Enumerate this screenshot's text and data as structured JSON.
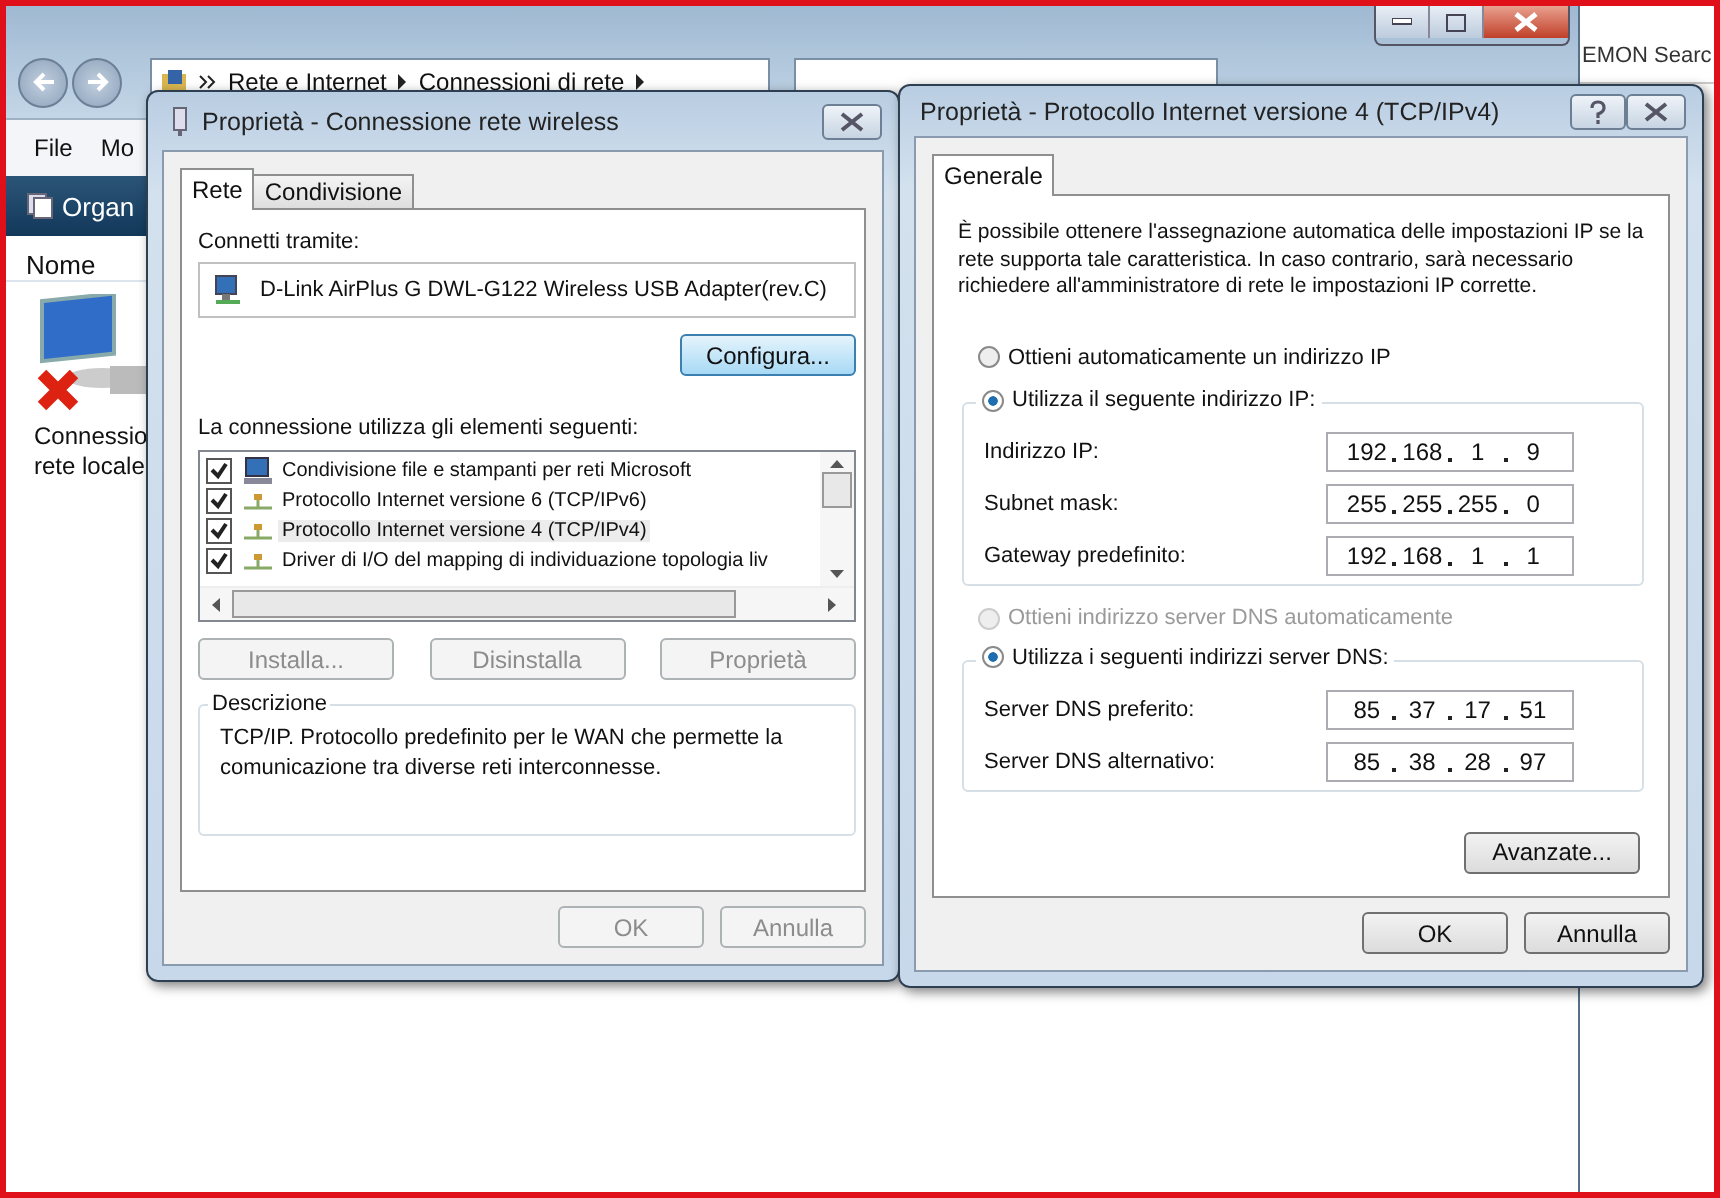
{
  "explorer": {
    "breadcrumb": [
      "Rete e Internet",
      "Connessioni di rete"
    ],
    "menu": [
      "File",
      "Mo"
    ],
    "toolbar_button": "Organ",
    "column": "Nome",
    "item_label": [
      "Connessio",
      "rete locale"
    ],
    "other_window_title": "EMON Searc"
  },
  "dialog_connection": {
    "title": "Proprietà - Connessione rete wireless",
    "tabs": [
      {
        "label": "Rete",
        "selected": true
      },
      {
        "label": "Condivisione",
        "selected": false
      }
    ],
    "connect_via_label": "Connetti tramite:",
    "adapter": "D-Link AirPlus G DWL-G122 Wireless USB Adapter(rev.C)",
    "configure_button": "Configura...",
    "components_label": "La connessione utilizza gli elementi seguenti:",
    "components": [
      {
        "kind": "service",
        "label": "Condivisione file e stampanti per reti Microsoft",
        "checked": true,
        "selected": false
      },
      {
        "kind": "protocol",
        "label": "Protocollo Internet versione 6 (TCP/IPv6)",
        "checked": true,
        "selected": false
      },
      {
        "kind": "protocol",
        "label": "Protocollo Internet versione 4 (TCP/IPv4)",
        "checked": true,
        "selected": true
      },
      {
        "kind": "protocol",
        "label": "Driver di I/O del mapping di individuazione topologia liv",
        "checked": true,
        "selected": false
      }
    ],
    "action_buttons": [
      {
        "label": "Installa...",
        "disabled": true
      },
      {
        "label": "Disinstalla",
        "disabled": true
      },
      {
        "label": "Proprietà",
        "disabled": true
      }
    ],
    "description_title": "Descrizione",
    "description": "TCP/IP. Protocollo predefinito per le WAN che permette la comunicazione tra diverse reti interconnesse.",
    "footer_buttons": [
      {
        "label": "OK",
        "disabled": true
      },
      {
        "label": "Annulla",
        "disabled": true
      }
    ]
  },
  "dialog_ipv4": {
    "title": "Proprietà - Protocollo Internet versione 4 (TCP/IPv4)",
    "tabs": [
      {
        "label": "Generale",
        "selected": true
      }
    ],
    "intro": "È possibile ottenere l'assegnazione automatica delle impostazioni IP se la rete supporta tale caratteristica. In caso contrario, sarà necessario richiedere all'amministratore di rete le impostazioni IP corrette.",
    "ip_auto": {
      "label": "Ottieni automaticamente un indirizzo IP",
      "selected": false,
      "disabled": false
    },
    "ip_manual": {
      "label": "Utilizza il seguente indirizzo IP:",
      "selected": true,
      "disabled": false
    },
    "ip_fields": [
      {
        "label": "Indirizzo IP:",
        "octets": [
          "192",
          "168",
          "1",
          "9"
        ]
      },
      {
        "label": "Subnet mask:",
        "octets": [
          "255",
          "255",
          "255",
          "0"
        ]
      },
      {
        "label": "Gateway predefinito:",
        "octets": [
          "192",
          "168",
          "1",
          "1"
        ]
      }
    ],
    "dns_auto": {
      "label": "Ottieni indirizzo server DNS automaticamente",
      "selected": false,
      "disabled": true
    },
    "dns_manual": {
      "label": "Utilizza i seguenti indirizzi server DNS:",
      "selected": true,
      "disabled": false
    },
    "dns_fields": [
      {
        "label": "Server DNS preferito:",
        "octets": [
          "85",
          "37",
          "17",
          "51"
        ]
      },
      {
        "label": "Server DNS alternativo:",
        "octets": [
          "85",
          "38",
          "28",
          "97"
        ]
      }
    ],
    "advanced_button": "Avanzate...",
    "footer_buttons": [
      {
        "label": "OK",
        "disabled": false
      },
      {
        "label": "Annulla",
        "disabled": false
      }
    ]
  }
}
